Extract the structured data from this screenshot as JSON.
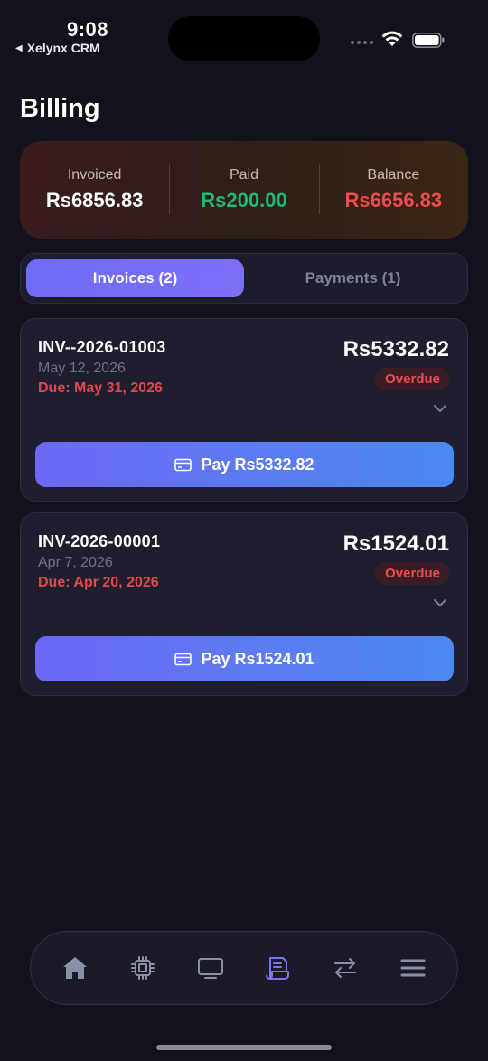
{
  "status_bar": {
    "time": "9:08",
    "back_app": "Xelynx CRM"
  },
  "page": {
    "title": "Billing"
  },
  "summary": {
    "invoiced_label": "Invoiced",
    "invoiced_value": "Rs6856.83",
    "paid_label": "Paid",
    "paid_value": "Rs200.00",
    "balance_label": "Balance",
    "balance_value": "Rs6656.83"
  },
  "tabs": [
    {
      "label": "Invoices (2)",
      "active": true
    },
    {
      "label": "Payments (1)",
      "active": false
    }
  ],
  "invoices": [
    {
      "number": "INV--2026-01003",
      "date": "May 12, 2026",
      "due": "Due: May 31, 2026",
      "amount": "Rs5332.82",
      "status": "Overdue",
      "pay_label": "Pay Rs5332.82"
    },
    {
      "number": "INV-2026-00001",
      "date": "Apr 7, 2026",
      "due": "Due: Apr 20, 2026",
      "amount": "Rs1524.01",
      "status": "Overdue",
      "pay_label": "Pay Rs1524.01"
    }
  ],
  "bottom_nav": [
    {
      "icon": "home-icon",
      "active": false
    },
    {
      "icon": "chip-icon",
      "active": false
    },
    {
      "icon": "monitor-icon",
      "active": false
    },
    {
      "icon": "receipt-icon",
      "active": true
    },
    {
      "icon": "transfer-arrows-icon",
      "active": false
    },
    {
      "icon": "menu-icon",
      "active": false
    }
  ],
  "colors": {
    "background": "#12121c",
    "accent": "#6f6cf6",
    "paid_green": "#22b873",
    "balance_red": "#ef4a4f",
    "overdue_red": "#e2474e"
  }
}
